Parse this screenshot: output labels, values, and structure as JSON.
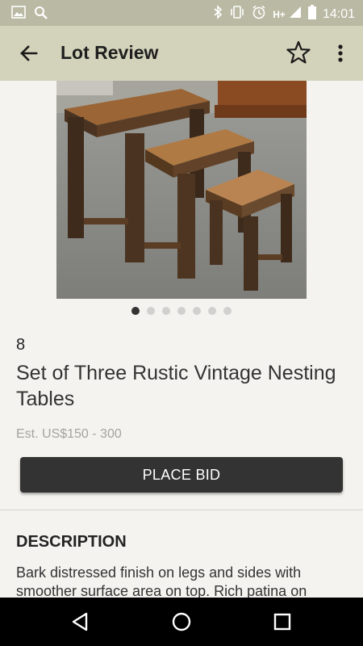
{
  "status_bar": {
    "network_label": "H+",
    "time": "14:01"
  },
  "app_bar": {
    "title": "Lot Review"
  },
  "gallery": {
    "image_count": 7,
    "active_index": 0
  },
  "lot": {
    "number": "8",
    "title": "Set of Three Rustic Vintage Nesting Tables",
    "estimate": "Est. US$150 - 300"
  },
  "actions": {
    "place_bid_label": "PLACE BID"
  },
  "description": {
    "heading": "DESCRIPTION",
    "text": "Bark distressed finish on legs and sides with smoother surface area on top. Rich patina on"
  },
  "colors": {
    "app_bar": "#d3d3bb",
    "status_bar": "#b9b9a4",
    "button": "#333333",
    "background": "#f4f3ef"
  },
  "icons": {
    "back": "arrow-left-icon",
    "favorite": "star-outline-icon",
    "more": "more-vertical-icon",
    "nav_back": "triangle-back-icon",
    "nav_home": "circle-home-icon",
    "nav_recents": "square-recents-icon"
  }
}
